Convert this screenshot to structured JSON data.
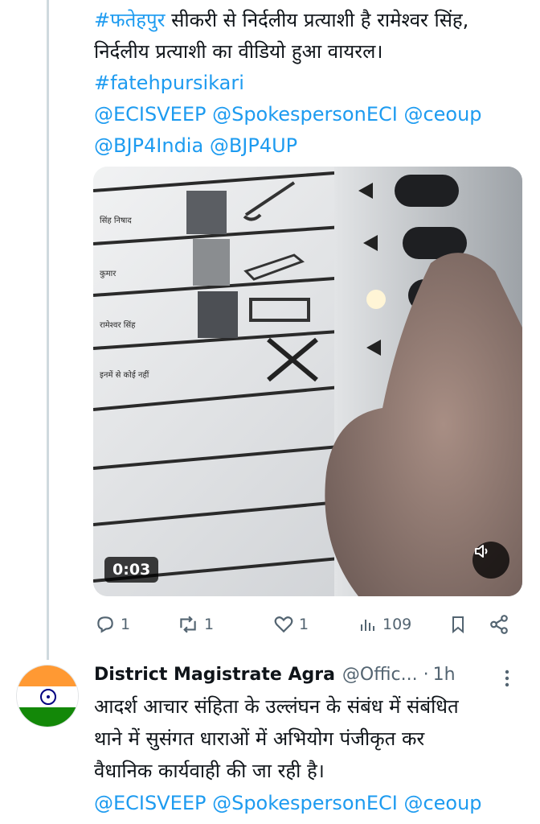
{
  "tweet1": {
    "hashtag": "#फतेहपुर",
    "line1_rest": " सीकरी से निर्दलीय प्रत्याशी है रामेश्वर सिंह,",
    "line2": "निर्दलीय प्रत्याशी का वीडियो हुआ वायरल।",
    "hashtag2": "#fatehpursikari",
    "mentions_line1": "@ECISVEEP @SpokespersonECI @ceoup",
    "mentions_line2": "@BJP4India @BJP4UP",
    "video": {
      "duration": "0:03",
      "ballot_rows": [
        "सिंह निषाद",
        "कुमार",
        "रामेश्वर सिंह",
        "इनमें से कोई नहीं"
      ]
    },
    "actions": {
      "replies": "1",
      "reposts": "1",
      "likes": "1",
      "views": "109"
    }
  },
  "tweet2": {
    "author_name": "District Magistrate Agra",
    "author_handle": "@Offic...",
    "separator": "·",
    "time": "1h",
    "text_line1": "आदर्श आचार संहिता के उल्लंघन के संबंध में संबंधित",
    "text_line2": "थाने में सुसंगत धाराओं में अभियोग पंजीकृत कर",
    "text_line3": "वैधानिक कार्यवाही की जा रही है।",
    "mentions": "@ECISVEEP @SpokespersonECI @ceoup"
  },
  "colors": {
    "link": "#1d9bf0",
    "muted": "#536471",
    "thread_line": "#cfd9de"
  }
}
